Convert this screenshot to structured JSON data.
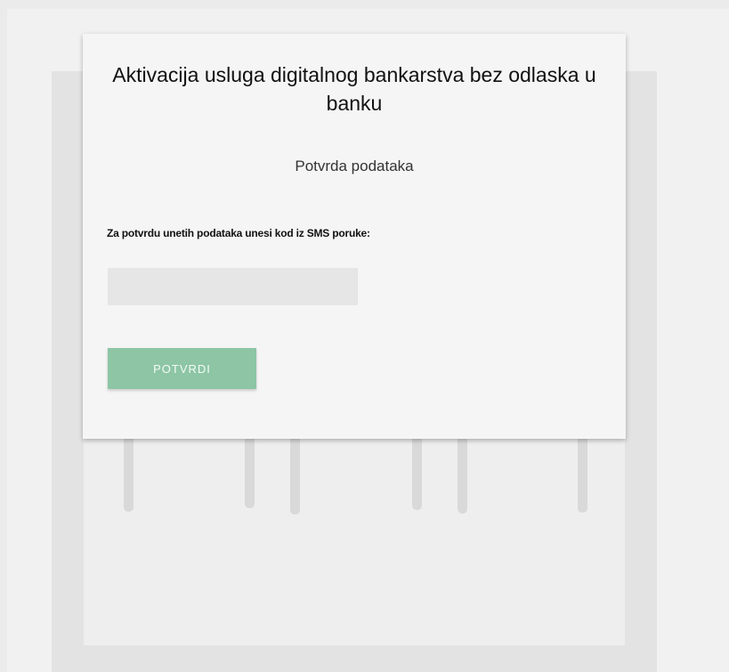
{
  "modal": {
    "title": "Aktivacija usluga digitalnog bankarstva bez odlaska u banku",
    "subtitle": "Potvrda podataka",
    "code_label": "Za potvrdu unetih podataka unesi kod iz SMS poruke:",
    "code_input": {
      "value": "",
      "placeholder": ""
    },
    "confirm_button_label": "POTVRDI"
  },
  "colors": {
    "page_background": "#ebebeb",
    "card_background": "#f5f5f5",
    "input_background": "#e6e6e6",
    "button_accent": "#8dc5a5",
    "button_text": "#f4fbf7"
  }
}
